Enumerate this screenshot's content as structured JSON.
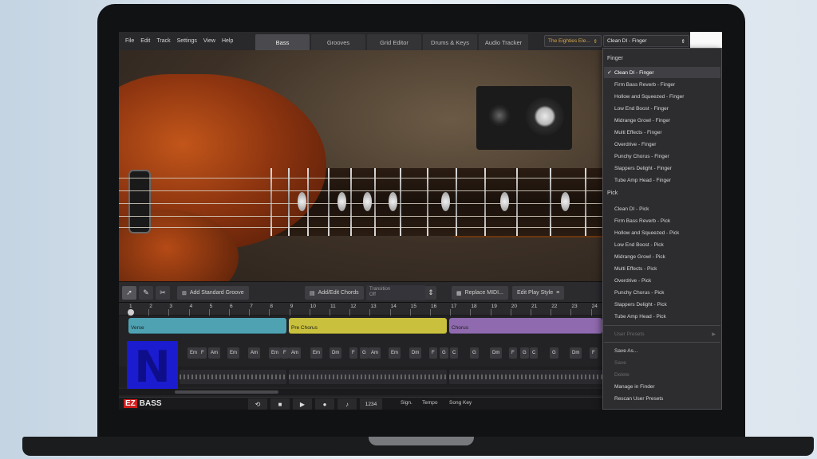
{
  "menus": [
    "File",
    "Edit",
    "Track",
    "Settings",
    "View",
    "Help"
  ],
  "tabs": [
    {
      "label": "Bass",
      "active": true
    },
    {
      "label": "Grooves",
      "active": false
    },
    {
      "label": "Grid Editor",
      "active": false
    },
    {
      "label": "Drums & Keys",
      "active": false
    },
    {
      "label": "Audio Tracker",
      "active": false
    }
  ],
  "preset_select_a": "The Eighties Ele...",
  "preset_select_b": "Clean DI - Finger",
  "toolbar": {
    "add_groove": "Add Standard Groove",
    "add_chords": "Add/Edit Chords",
    "transition_label": "Transition",
    "transition_value": "Off",
    "replace_midi": "Replace MIDI...",
    "edit_play_style": "Edit Play Style"
  },
  "ruler_ticks": [
    "1",
    "2",
    "3",
    "4",
    "5",
    "6",
    "7",
    "8",
    "9",
    "10",
    "11",
    "12",
    "13",
    "14",
    "15",
    "16",
    "17",
    "18",
    "19",
    "20",
    "21",
    "22",
    "23",
    "24"
  ],
  "sections": [
    {
      "label": "Verse",
      "cls": "sec-verse"
    },
    {
      "label": "Pre Chorus",
      "cls": "sec-pre"
    },
    {
      "label": "Chorus",
      "cls": "sec-chorus"
    }
  ],
  "chords": [
    "Em",
    "F",
    "Am",
    "Em",
    "Am",
    "Em",
    "F",
    "Am",
    "Em",
    "Dm",
    "F",
    "G",
    "Am",
    "Em",
    "Dm",
    "F",
    "G",
    "C",
    "G",
    "Dm",
    "F",
    "G",
    "C",
    "G",
    "Dm",
    "F"
  ],
  "transport": {
    "logo_ez": "EZ",
    "logo_text": "BASS",
    "sign": "Sign.",
    "tempo": "Tempo",
    "song_key": "Song Key",
    "count": "1234"
  },
  "dropdown": {
    "finger_header": "Finger",
    "finger_items": [
      "Clean DI - Finger",
      "Firm Bass Reverb - Finger",
      "Hollow and Squeezed - Finger",
      "Low End Boost - Finger",
      "Midrange Growl - Finger",
      "Multi Effects - Finger",
      "Overdrive - Finger",
      "Punchy Chorus - Finger",
      "Slappers Delight - Finger",
      "Tube Amp Head - Finger"
    ],
    "pick_header": "Pick",
    "pick_items": [
      "Clean DI - Pick",
      "Firm Bass Reverb - Pick",
      "Hollow and Squeezed - Pick",
      "Low End Boost - Pick",
      "Midrange Growl - Pick",
      "Multi Effects - Pick",
      "Overdrive - Pick",
      "Punchy Chorus - Pick",
      "Slappers Delight - Pick",
      "Tube Amp Head - Pick"
    ],
    "user_presets": "User Presets",
    "save_as": "Save As...",
    "save": "Save",
    "delete": "Delete",
    "manage": "Manage in Finder",
    "rescan": "Rescan User Presets"
  },
  "logo_letter": "N"
}
